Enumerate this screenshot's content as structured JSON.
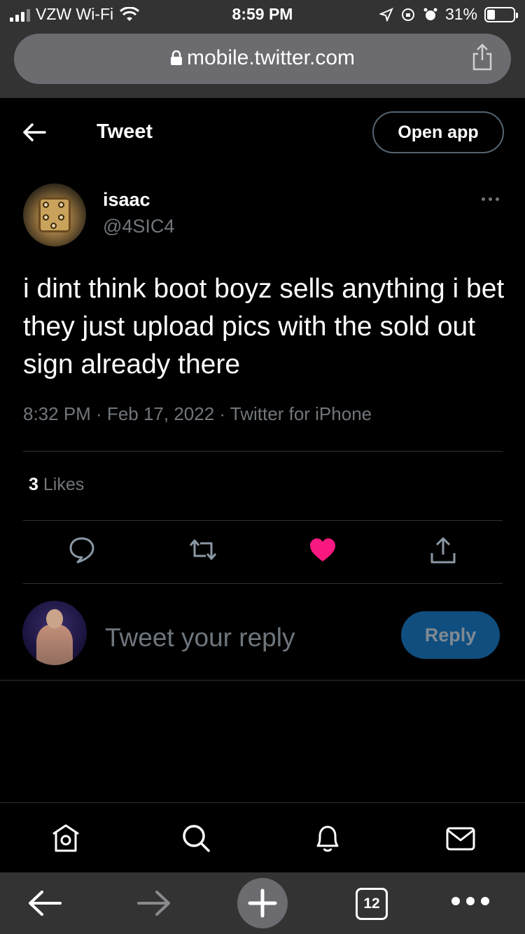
{
  "status_bar": {
    "carrier": "VZW Wi-Fi",
    "time": "8:59 PM",
    "battery": "31%"
  },
  "browser": {
    "url": "mobile.twitter.com",
    "tabs_count": "12"
  },
  "header": {
    "title": "Tweet",
    "open_app_label": "Open app"
  },
  "tweet": {
    "author_name": "isaac",
    "author_handle": "@4SIC4",
    "text": "i dint think boot boyz sells anything i bet they just upload pics with the sold out sign already there",
    "meta": "8:32 PM · Feb 17, 2022 · Twitter for iPhone",
    "likes_count": "3",
    "likes_label": "Likes",
    "liked": true
  },
  "reply": {
    "placeholder": "Tweet your reply",
    "button_label": "Reply"
  },
  "colors": {
    "background": "#000000",
    "like_pink": "#f91880",
    "secondary_text": "#71767b",
    "reply_button": "#0f4e7f"
  },
  "icons": {
    "tw_nav": [
      "home-icon",
      "search-icon",
      "notifications-icon",
      "messages-icon"
    ],
    "actions": [
      "reply-icon",
      "retweet-icon",
      "like-icon",
      "share-icon"
    ]
  }
}
